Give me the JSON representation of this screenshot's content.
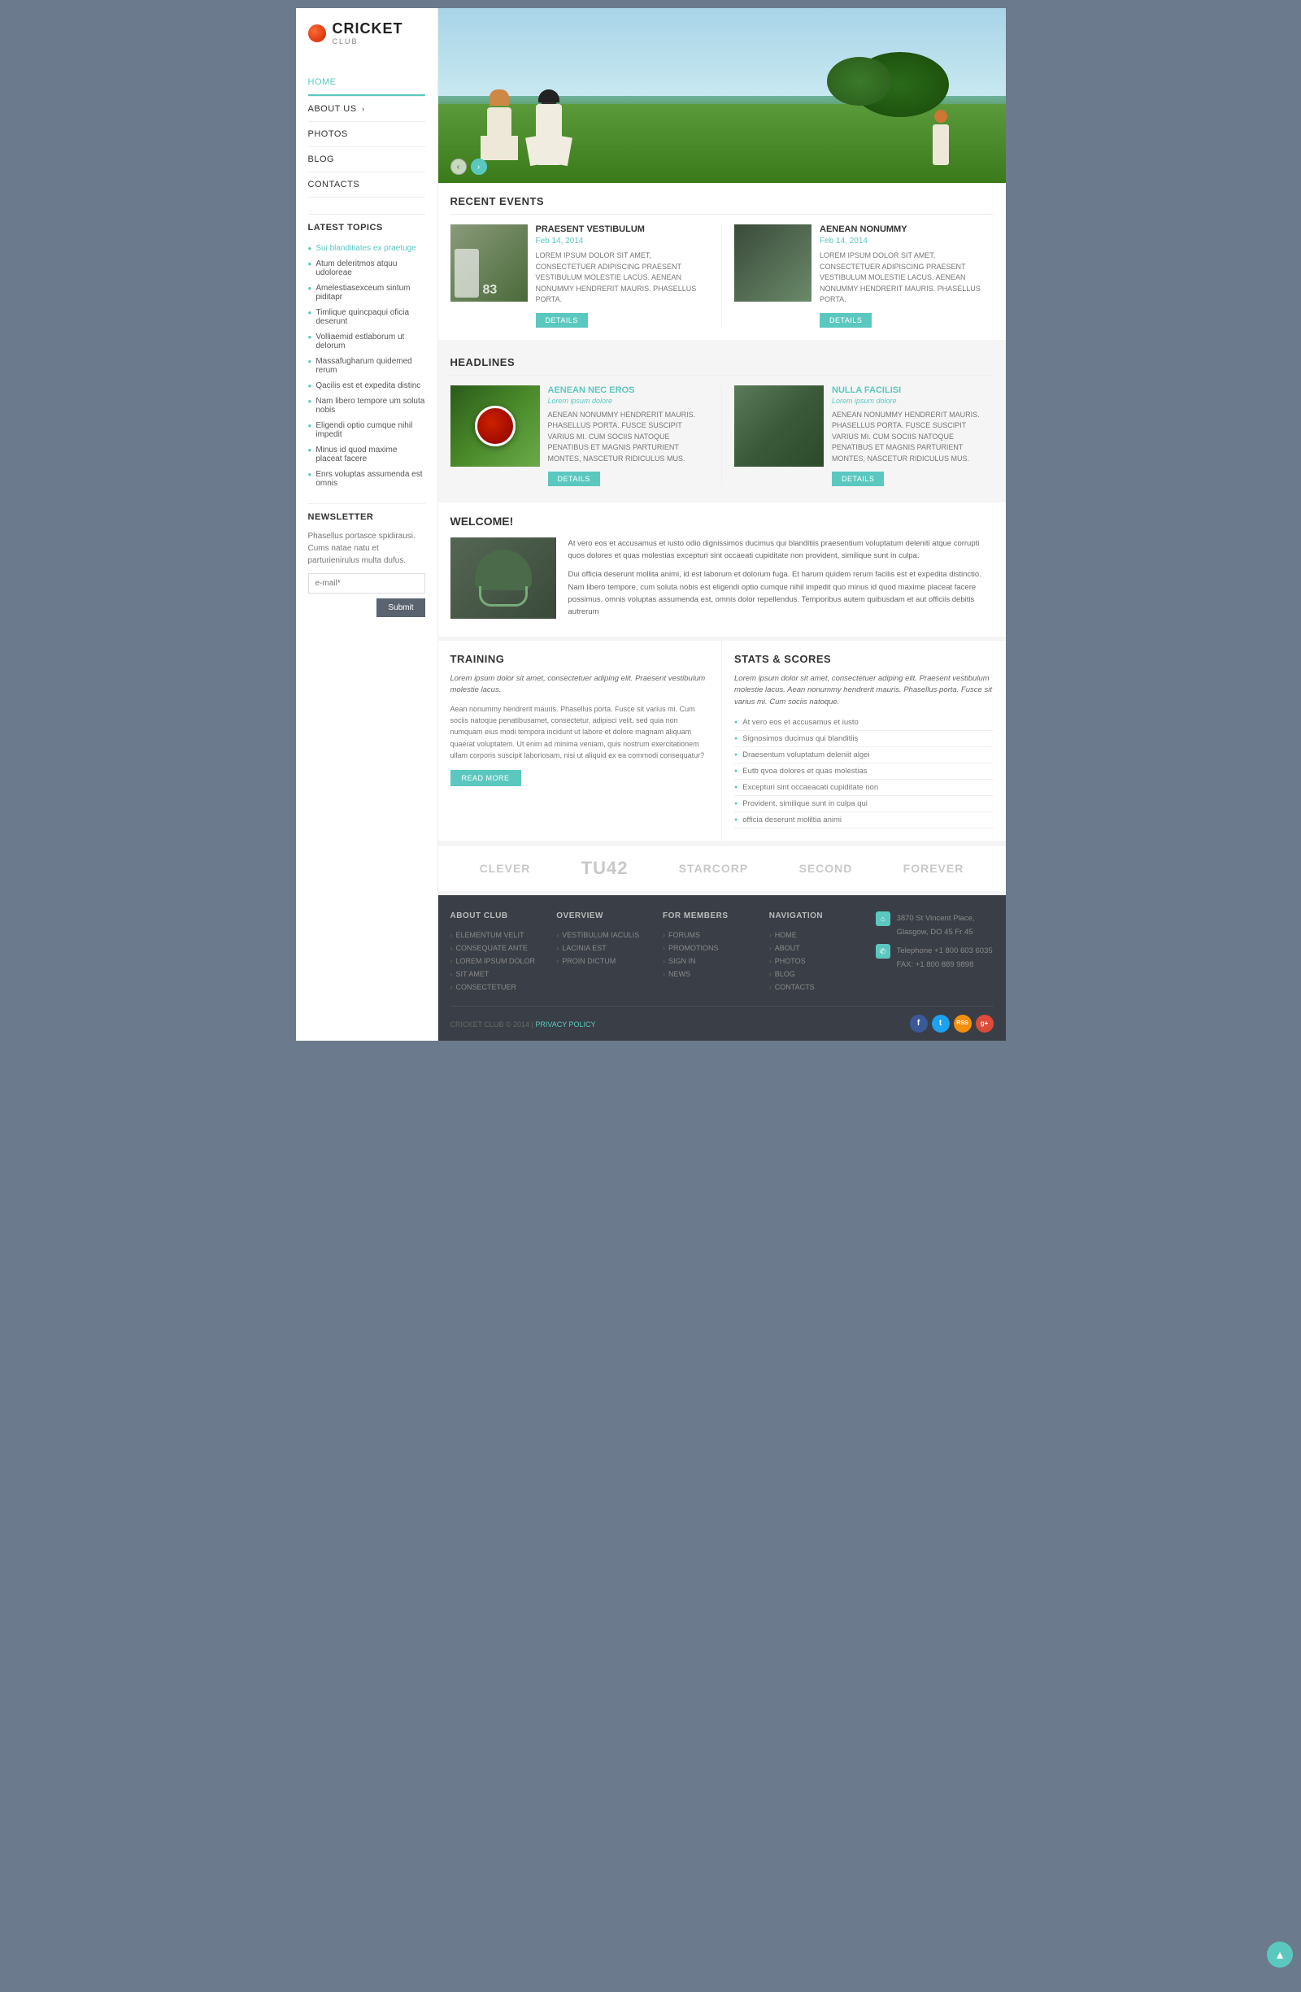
{
  "site": {
    "logo_cricket": "CRICKET",
    "logo_club": "CLUB"
  },
  "nav": {
    "items": [
      {
        "label": "HOME",
        "active": true
      },
      {
        "label": "ABOUT US",
        "arrow": "›"
      },
      {
        "label": "PHOTOS"
      },
      {
        "label": "BLOG"
      },
      {
        "label": "CONTACTS"
      }
    ]
  },
  "sidebar": {
    "latest_topics_title": "LATEST TOPICS",
    "topics": [
      {
        "label": "Sui blanditiates ex praetuge",
        "active": true
      },
      {
        "label": "Atum deleritmos atquu udoloreae"
      },
      {
        "label": "Amelestiasexceum sintum piditapr"
      },
      {
        "label": "Timlique quincpaqui oficia deserunt"
      },
      {
        "label": "Volliaemid estlaborum ut delorum"
      },
      {
        "label": "Massafugharum quidemed rerum"
      },
      {
        "label": "Qacilis est et expedita distinc"
      },
      {
        "label": "Nam libero tempore um soluta nobis"
      },
      {
        "label": "Eligendi optio cumque nihil impedit"
      },
      {
        "label": "Minus id quod maxime placeat facere"
      },
      {
        "label": "Enrs voluptas assumenda est omnis"
      }
    ],
    "newsletter_title": "NEWSLETTER",
    "newsletter_text": "Phasellus portasce spidirausi. Cums natae natu et parturienirulus multa dufus.",
    "newsletter_placeholder": "e-mail*",
    "newsletter_submit": "Submit"
  },
  "hero": {
    "slider_prev": "‹",
    "slider_next": "›"
  },
  "recent_events": {
    "title": "RECENT EVENTS",
    "events": [
      {
        "title": "PRAESENT VESTIBULUM",
        "date": "Feb 14, 2014",
        "text": "LOREM IPSUM DOLOR SIT AMET, CONSECTETUER ADIPISCING PRAESENT VESTIBULUM MOLESTIE LACUS. AENEAN NONUMMY HENDRERIT MAURIS. PHASELLUS PORTA.",
        "details_label": "DETAILS"
      },
      {
        "title": "AENEAN NONUMMY",
        "date": "Feb 14, 2014",
        "text": "LOREM IPSUM DOLOR SIT AMET, CONSECTETUER ADIPISCING PRAESENT VESTIBULUM MOLESTIE LACUS. AENEAN NONUMMY HENDRERIT MAURIS. PHASELLUS PORTA.",
        "details_label": "DETAILS"
      }
    ]
  },
  "headlines": {
    "title": "HEADLINES",
    "items": [
      {
        "title": "AENEAN NEC EROS",
        "subtitle": "Lorem ipsum dolore",
        "text": "AENEAN NONUMMY HENDRERIT MAURIS. PHASELLUS PORTA. FUSCE SUSCIPIT VARIUS MI. CUM SOCIIS NATOQUE PENATIBUS ET MAGNIS PARTURIENT MONTES, NASCETUR RIDICULUS MUS.",
        "details_label": "DETAILS"
      },
      {
        "title": "NULLA FACILISI",
        "subtitle": "Lorem ipsum dolore",
        "text": "AENEAN NONUMMY HENDRERIT MAURIS. PHASELLUS PORTA. FUSCE SUSCIPIT VARIUS MI. CUM SOCIIS NATOQUE PENATIBUS ET MAGNIS PARTURIENT MONTES, NASCETUR RIDICULUS MUS.",
        "details_label": "DETAILS"
      }
    ]
  },
  "welcome": {
    "title": "WELCOME!",
    "text1": "At vero eos et accusamus et iusto odio dignissimos ducimus qui blanditiis praesentium voluptatum deleniti atque corrupti quos dolores et quas molestias excepturi sint occaeati cupiditate non provident, similique sunt in culpa.",
    "text2": "Dui officia deserunt mollita animi, id est laborum et dolorum fuga. Et harum quidem rerum facilis est et expedita distinctio. Nam libero tempore, cum soluta nobis est eligendi optio cumque nihil impedit quo minus id quod maxime placeat facere possimus, omnis voluptas assumenda est, omnis dolor repellendus. Temporibus autem quibusdam et aut officiis debitis autrerum"
  },
  "training": {
    "title": "TRAINING",
    "intro": "Lorem ipsum dolor sit amet, consectetuer adiping elit. Praesent vestibulum molestie lacus.",
    "text": "Aean nonummy hendrerit mauris. Phasellus porta. Fusce sit varius mi. Cum sociis natoque penatibusamet, consectetur, adipisci velit, sed quia non numquam eius modi tempora incidunt ut labore et dolore magnam aliquam quaerat voluptatem. Ut enim ad minima veniam, quis nostrum exercitationem ullam corporis suscipit laboriosam, nisi ut aliquid ex ea commodi consequatur?",
    "read_more": "READ MORE"
  },
  "stats": {
    "title": "STATS & SCORES",
    "intro": "Lorem ipsum dolor sit amet, consectetuer adiping elit. Praesent vestibulum molestie lacus. Aean nonummy hendrerit mauris. Phasellus porta. Fusce sit varius mi. Cum sociis natoque.",
    "items": [
      "At vero eos et accusamus et iusto",
      "Signosimos ducimus qui blanditiis",
      "Draesentum voluptatum deleniit algei",
      "Eutb qvoa dolores et quas molestias",
      "Excepturi sint occaeacati cupiditate non",
      "Provident, similique sunt in culpa qui",
      "officia deserunt moliltia animi"
    ]
  },
  "sponsors": [
    {
      "name": "CLEVER",
      "size": "normal"
    },
    {
      "name": "TU42",
      "size": "large"
    },
    {
      "name": "STARCORP",
      "size": "normal"
    },
    {
      "name": "SECOND",
      "size": "normal"
    },
    {
      "name": "FOREVER",
      "size": "normal"
    }
  ],
  "footer": {
    "about_title": "ABOUT CLUB",
    "about_links": [
      "ELEMENTUM VELIT",
      "CONSEQUATE ANTE",
      "LOREM IPSUM DOLOR",
      "SIT AMET",
      "CONSECTETUER"
    ],
    "overview_title": "OVERVIEW",
    "overview_links": [
      "VESTIBULUM IACULIS",
      "LACINIA EST",
      "PROIN DICTUM"
    ],
    "members_title": "FOR MEMBERS",
    "members_links": [
      "FORUMS",
      "PROMOTIONS",
      "SIGN IN",
      "NEWS"
    ],
    "nav_title": "NAVIGATION",
    "nav_links": [
      "HOME",
      "ABOUT",
      "PHOTOS",
      "BLOG",
      "CONTACTS"
    ],
    "address": "3870 St Vincent Place, Glasgow, DO 45 Fr 45",
    "telephone": "Telephone  +1 800 603 6035",
    "fax": "FAX:    +1 800 889 9898",
    "copyright": "CRICKET CLUB © 2014 |",
    "privacy": "PRIVACY POLICY",
    "social": [
      "f",
      "t",
      "rss",
      "g+"
    ]
  }
}
